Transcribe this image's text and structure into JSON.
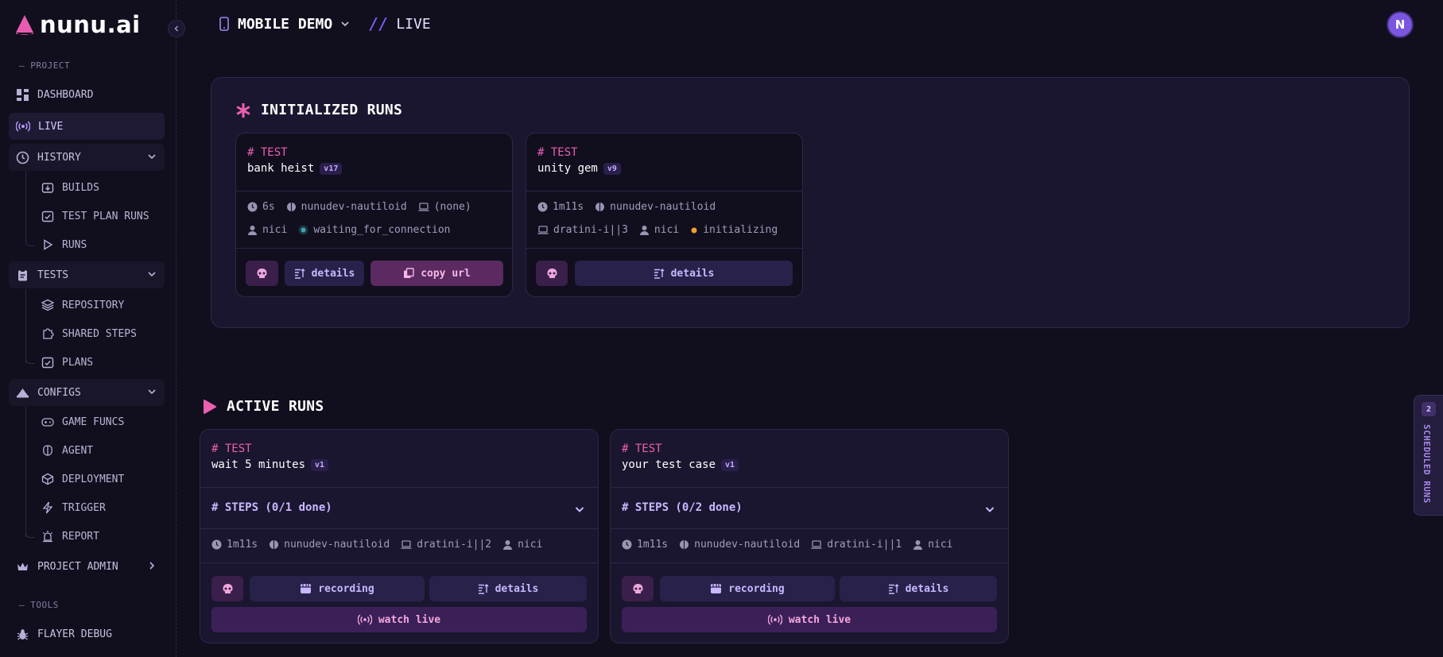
{
  "app": {
    "logo_text": "nunu.ai"
  },
  "sidebar": {
    "project_label": "— PROJECT",
    "tools_label": "— TOOLS",
    "dashboard": "DASHBOARD",
    "live": "LIVE",
    "history": "HISTORY",
    "history_items": [
      "BUILDS",
      "TEST PLAN RUNS",
      "RUNS"
    ],
    "tests": "TESTS",
    "tests_items": [
      "REPOSITORY",
      "SHARED STEPS",
      "PLANS"
    ],
    "configs": "CONFIGS",
    "configs_items": [
      "GAME FUNCS",
      "AGENT",
      "DEPLOYMENT",
      "TRIGGER",
      "REPORT"
    ],
    "project_admin": "PROJECT ADMIN",
    "player_debug": "FLAYER DEBUG"
  },
  "header": {
    "project": "MOBILE DEMO",
    "slashes": "//",
    "page": "LIVE"
  },
  "user": {
    "avatar_initial": "N"
  },
  "initialized": {
    "title": "INITIALIZED RUNS",
    "cards": [
      {
        "type": "# TEST",
        "name": "bank heist",
        "version": "v17",
        "time": "6s",
        "agent": "nunudev-nautiloid",
        "device": "(none)",
        "user": "nici",
        "status": "waiting_for_connection",
        "status_color": "#3aa8b0",
        "details": "details",
        "copy": "copy url"
      },
      {
        "type": "# TEST",
        "name": "unity gem",
        "version": "v9",
        "time": "1m11s",
        "agent": "nunudev-nautiloid",
        "device": "dratini-i||3",
        "user": "nici",
        "status": "initializing",
        "status_color": "#f0a030",
        "details": "details"
      }
    ]
  },
  "active": {
    "title": "ACTIVE RUNS",
    "cards": [
      {
        "type": "# TEST",
        "name": "wait 5 minutes",
        "version": "v1",
        "steps": "# STEPS (0/1 done)",
        "time": "1m11s",
        "agent": "nunudev-nautiloid",
        "device": "dratini-i||2",
        "user": "nici",
        "recording": "recording",
        "details": "details",
        "watch": "watch live"
      },
      {
        "type": "# TEST",
        "name": "your test case",
        "version": "v1",
        "steps": "# STEPS (0/2 done)",
        "time": "1m11s",
        "agent": "nunudev-nautiloid",
        "device": "dratini-i||1",
        "user": "nici",
        "recording": "recording",
        "details": "details",
        "watch": "watch live"
      }
    ]
  },
  "scheduled": {
    "count": "2",
    "label": "SCHEDULED RUNS"
  },
  "colors": {
    "accent_pink": "#ec5fb0",
    "accent_purple": "#7c5cf0",
    "background": "#110e1e"
  }
}
